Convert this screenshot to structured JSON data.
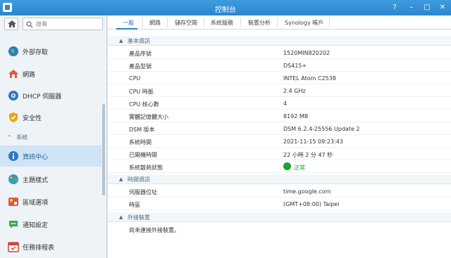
{
  "window": {
    "title": "控制台"
  },
  "sidebar": {
    "search_placeholder": "搜尋",
    "items": [
      {
        "label": "外部存取",
        "icon": "globe-icon"
      },
      {
        "label": "網路",
        "icon": "house-network-icon"
      },
      {
        "label": "DHCP 伺服器",
        "icon": "dhcp-icon"
      },
      {
        "label": "安全性",
        "icon": "shield-icon"
      },
      {
        "label": "資訊中心",
        "icon": "info-icon",
        "active": true
      },
      {
        "label": "主題樣式",
        "icon": "palette-icon"
      },
      {
        "label": "區域選項",
        "icon": "region-icon"
      },
      {
        "label": "通知設定",
        "icon": "notification-icon"
      },
      {
        "label": "任務排程表",
        "icon": "calendar-icon"
      }
    ],
    "section_system": "系統"
  },
  "tabs": [
    "一般",
    "網路",
    "儲存空間",
    "系統服務",
    "裝置分析",
    "Synology 帳戶"
  ],
  "sections": {
    "basic": {
      "title": "基本資訊",
      "rows": [
        {
          "key": "產品序號",
          "value": "1520MIN820202"
        },
        {
          "key": "產品型號",
          "value": "DS415+"
        },
        {
          "key": "CPU",
          "value": "INTEL Atom C2538"
        },
        {
          "key": "CPU 時脈",
          "value": "2.4 GHz"
        },
        {
          "key": "CPU 核心數",
          "value": "4"
        },
        {
          "key": "實體記憶體大小",
          "value": "8192 MB"
        },
        {
          "key": "DSM 版本",
          "value": "DSM 6.2.4-25556 Update 2"
        },
        {
          "key": "系統時間",
          "value": "2021-11-15 09:23:43"
        },
        {
          "key": "已開機時間",
          "value": "22 小時 2 分 47 秒"
        },
        {
          "key": "系統散熱狀態",
          "value": "正常"
        }
      ]
    },
    "time": {
      "title": "時間資訊",
      "rows": [
        {
          "key": "伺服器位址",
          "value": "time.google.com"
        },
        {
          "key": "時區",
          "value": "(GMT+08:00) Taipei"
        }
      ]
    },
    "external": {
      "title": "外接裝置",
      "empty_text": "尚未連接外接裝置。"
    }
  },
  "colors": {
    "titlebar": "#2c86cf",
    "status_ok": "#1aa32b",
    "active_item": "#cfe4f5"
  }
}
